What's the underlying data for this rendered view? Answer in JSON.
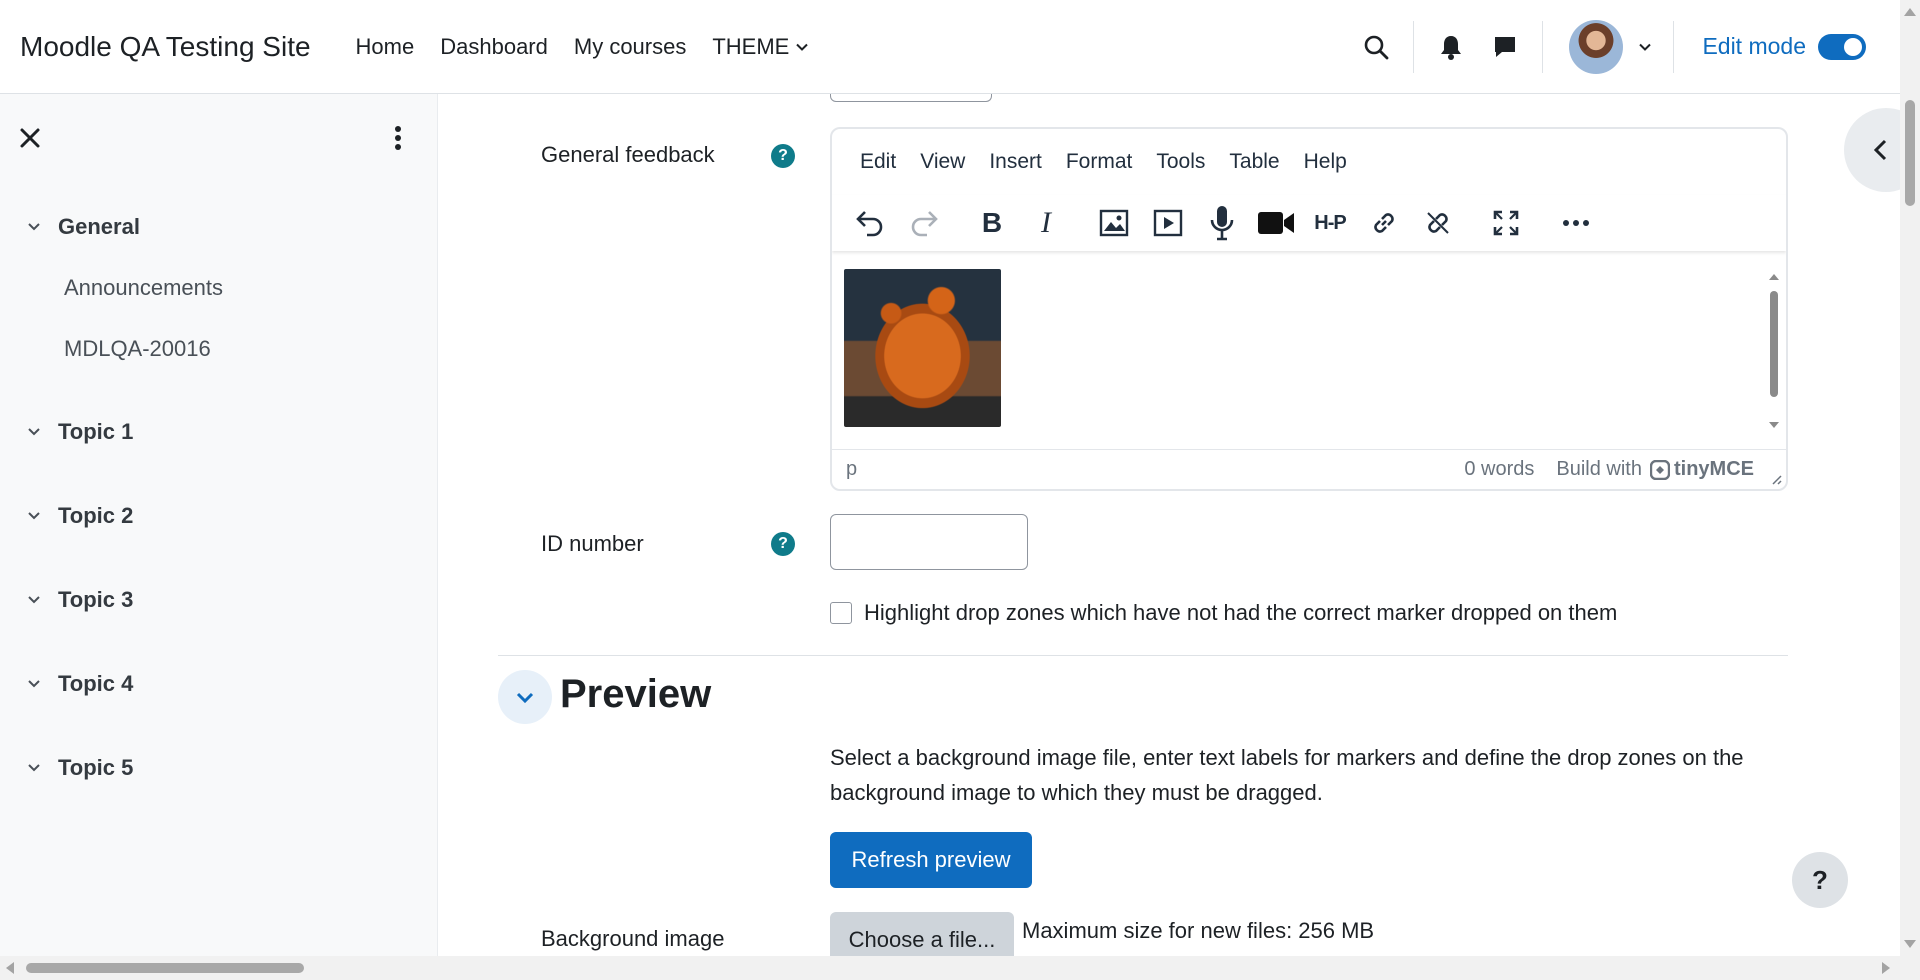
{
  "navbar": {
    "site_name": "Moodle QA Testing Site",
    "nav_items": [
      "Home",
      "Dashboard",
      "My courses",
      "THEME"
    ],
    "edit_mode_label": "Edit mode",
    "edit_mode_on": true
  },
  "drawer": {
    "sections": [
      {
        "title": "General",
        "items": [
          "Announcements",
          "MDLQA-20016"
        ]
      },
      {
        "title": "Topic 1",
        "items": []
      },
      {
        "title": "Topic 2",
        "items": []
      },
      {
        "title": "Topic 3",
        "items": []
      },
      {
        "title": "Topic 4",
        "items": []
      },
      {
        "title": "Topic 5",
        "items": []
      }
    ]
  },
  "form": {
    "general_feedback_label": "General feedback",
    "help_symbol": "?",
    "editor": {
      "menu": [
        "Edit",
        "View",
        "Insert",
        "Format",
        "Tools",
        "Table",
        "Help"
      ],
      "toolbar_icons": [
        "undo-icon",
        "redo-icon",
        "bold-icon",
        "italic-icon",
        "image-icon",
        "media-icon",
        "record-audio-icon",
        "record-video-icon",
        "h5p-icon",
        "link-icon",
        "unlink-icon",
        "fullscreen-icon",
        "more-icon"
      ],
      "bold_glyph": "B",
      "italic_glyph": "I",
      "h5p_glyph": "H-P",
      "status_path": "p",
      "word_count": "0 words",
      "build_with": "Build with",
      "brand": "tinyMCE"
    },
    "id_number_label": "ID number",
    "id_number_value": "",
    "highlight_label": "Highlight drop zones which have not had the correct marker dropped on them",
    "highlight_checked": false
  },
  "preview": {
    "title": "Preview",
    "description": "Select a background image file, enter text labels for markers and define the drop zones on the background image to which they must be dragged.",
    "refresh_button": "Refresh preview",
    "background_image_label": "Background image",
    "choose_file_button": "Choose a file...",
    "max_size": "Maximum size for new files: 256 MB"
  },
  "help_button": "?",
  "colors": {
    "primary": "#0f6cbf",
    "help_icon": "#0f7b8a",
    "drawer_bg": "#f8f9fa"
  }
}
